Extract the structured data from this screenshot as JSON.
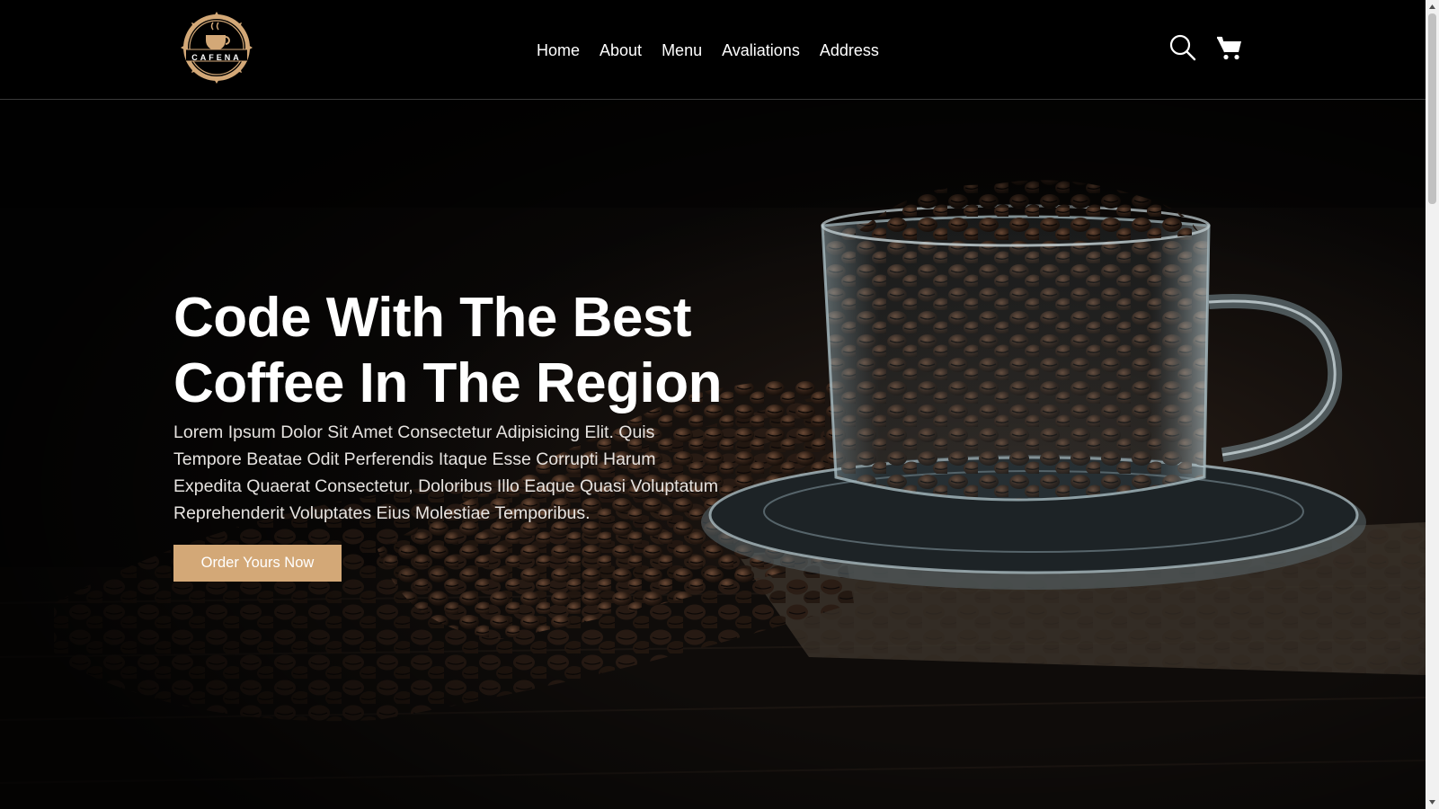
{
  "header": {
    "logo_text": "CAFENA",
    "nav": [
      {
        "label": "Home"
      },
      {
        "label": "About"
      },
      {
        "label": "Menu"
      },
      {
        "label": "Avaliations"
      },
      {
        "label": "Address"
      }
    ],
    "search_icon": "search-icon",
    "cart_icon": "cart-icon"
  },
  "hero": {
    "title_line1": "Code With The Best",
    "title_line2": "Coffee In The Region",
    "description": "Lorem Ipsum Dolor Sit Amet Consectetur Adipisicing Elit. Quis Tempore Beatae Odit Perferendis Itaque Esse Corrupti Harum Expedita Quaerat Consectetur, Doloribus Illo Eaque Quasi Voluptatum Reprehenderit Voluptates Eius Molestiae Temporibus.",
    "cta_label": "Order Yours Now"
  },
  "colors": {
    "accent": "#d3a877",
    "header_bg": "#000000",
    "hero_bg": "#0b0a09"
  }
}
